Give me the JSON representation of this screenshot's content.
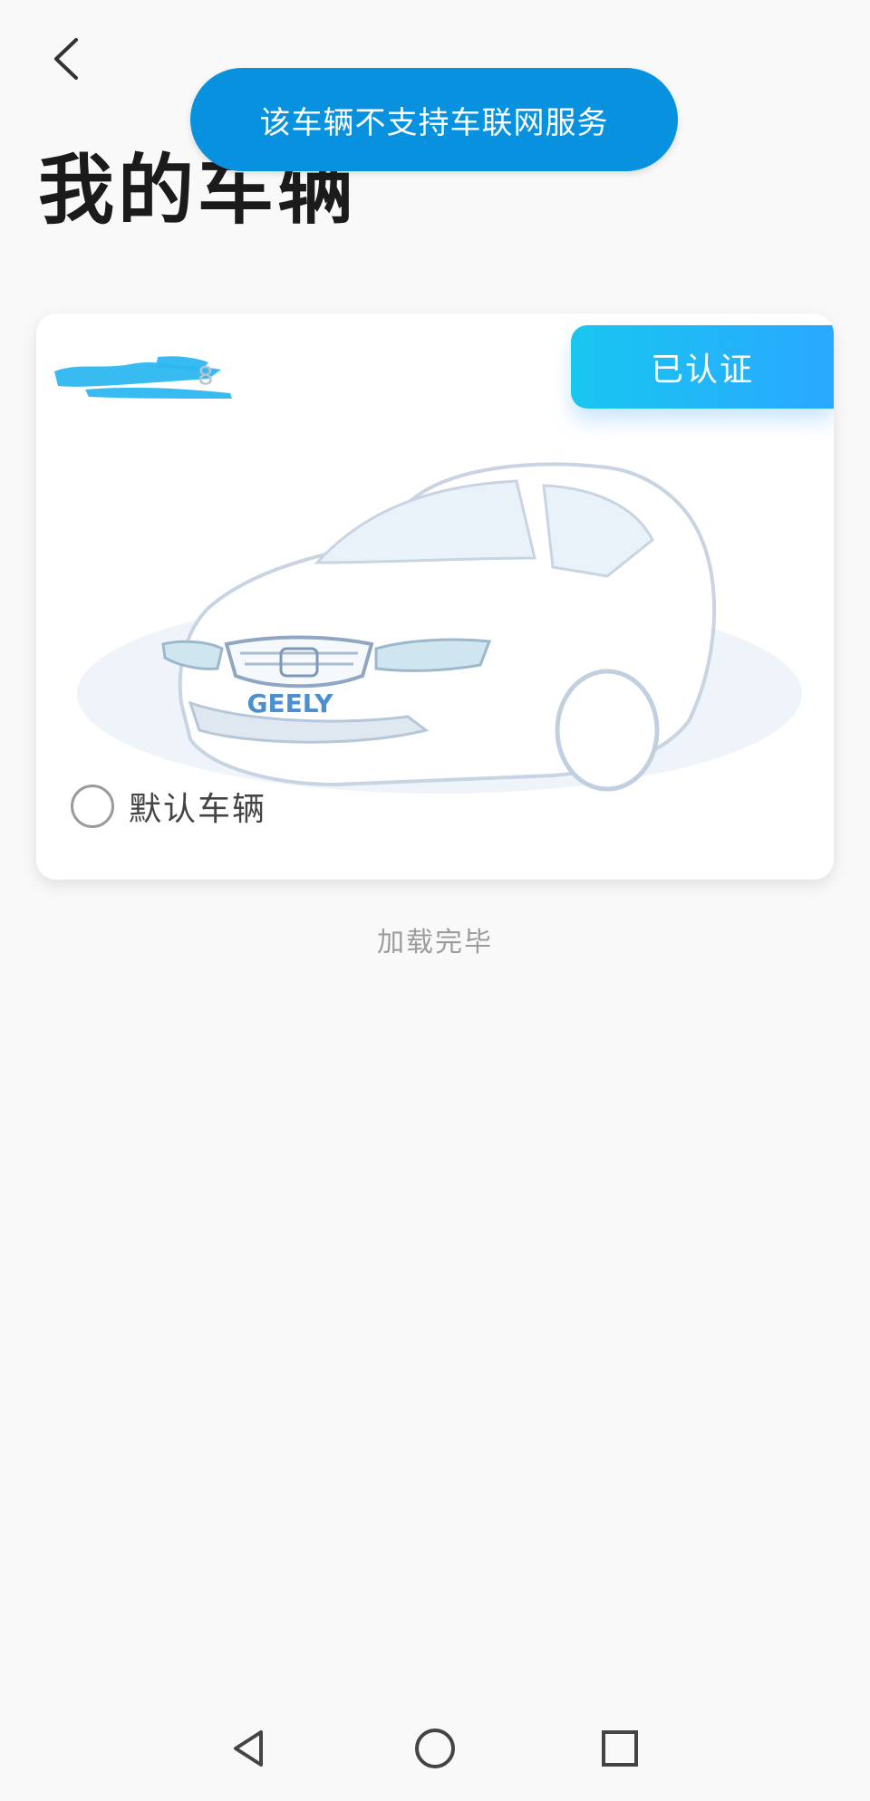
{
  "toast": {
    "message": "该车辆不支持车联网服务"
  },
  "header": {
    "title": "我的车辆"
  },
  "vehicle": {
    "plate_visible_suffix": "8",
    "status_badge": "已认证",
    "brand_label": "GEELY",
    "default_label": "默认车辆",
    "default_selected": false
  },
  "list": {
    "status": "加载完毕"
  },
  "icons": {
    "back": "chevron-left-icon",
    "nav_back": "triangle-back-icon",
    "nav_home": "circle-home-icon",
    "nav_recents": "square-recents-icon"
  },
  "colors": {
    "toast_bg": "#0891df",
    "badge_start": "#18c6f0",
    "badge_end": "#2aa8ff",
    "redaction": "#2db7f0"
  }
}
